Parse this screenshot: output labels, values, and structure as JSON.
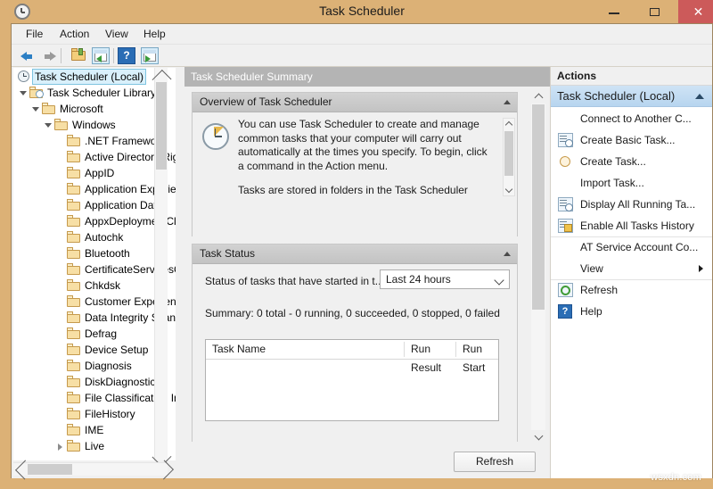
{
  "window": {
    "title": "Task Scheduler",
    "icon": "clock-icon",
    "minimize_label": "–",
    "maximize_label": "□",
    "close_label": "✕"
  },
  "menu": {
    "items": [
      {
        "label": "File"
      },
      {
        "label": "Action"
      },
      {
        "label": "View"
      },
      {
        "label": "Help"
      }
    ]
  },
  "toolbar": {
    "items": [
      {
        "name": "back-icon",
        "label": "Back"
      },
      {
        "name": "forward-icon",
        "label": "Forward"
      },
      {
        "name": "up-one-level-icon",
        "label": "Up One Level"
      },
      {
        "name": "show-hide-console-tree-icon",
        "label": "Show/Hide Console Tree"
      },
      {
        "name": "help-icon",
        "label": "Help"
      },
      {
        "name": "show-hide-action-pane-icon",
        "label": "Show/Hide Action Pane"
      }
    ]
  },
  "tree": {
    "items": [
      {
        "label": "Task Scheduler (Local)",
        "depth": 0,
        "icon": "clock-icon",
        "expander": "none",
        "selected": true
      },
      {
        "label": "Task Scheduler Library",
        "depth": 1,
        "icon": "clock-folder-icon",
        "expander": "open",
        "selected": false
      },
      {
        "label": "Microsoft",
        "depth": 2,
        "icon": "folder-icon",
        "expander": "open",
        "selected": false
      },
      {
        "label": "Windows",
        "depth": 3,
        "icon": "folder-icon",
        "expander": "open",
        "selected": false
      },
      {
        "label": ".NET Framework",
        "depth": 4,
        "icon": "folder-icon",
        "expander": "none",
        "selected": false
      },
      {
        "label": "Active Directory Rights Management",
        "depth": 4,
        "icon": "folder-icon",
        "expander": "none",
        "selected": false
      },
      {
        "label": "AppID",
        "depth": 4,
        "icon": "folder-icon",
        "expander": "none",
        "selected": false
      },
      {
        "label": "Application Experience",
        "depth": 4,
        "icon": "folder-icon",
        "expander": "none",
        "selected": false
      },
      {
        "label": "Application Data",
        "depth": 4,
        "icon": "folder-icon",
        "expander": "none",
        "selected": false
      },
      {
        "label": "AppxDeploymentClient",
        "depth": 4,
        "icon": "folder-icon",
        "expander": "none",
        "selected": false
      },
      {
        "label": "Autochk",
        "depth": 4,
        "icon": "folder-icon",
        "expander": "none",
        "selected": false
      },
      {
        "label": "Bluetooth",
        "depth": 4,
        "icon": "folder-icon",
        "expander": "none",
        "selected": false
      },
      {
        "label": "CertificateServicesClient",
        "depth": 4,
        "icon": "folder-icon",
        "expander": "none",
        "selected": false
      },
      {
        "label": "Chkdsk",
        "depth": 4,
        "icon": "folder-icon",
        "expander": "none",
        "selected": false
      },
      {
        "label": "Customer Experience Improvement Program",
        "depth": 4,
        "icon": "folder-icon",
        "expander": "none",
        "selected": false
      },
      {
        "label": "Data Integrity Scan",
        "depth": 4,
        "icon": "folder-icon",
        "expander": "none",
        "selected": false
      },
      {
        "label": "Defrag",
        "depth": 4,
        "icon": "folder-icon",
        "expander": "none",
        "selected": false
      },
      {
        "label": "Device Setup",
        "depth": 4,
        "icon": "folder-icon",
        "expander": "none",
        "selected": false
      },
      {
        "label": "Diagnosis",
        "depth": 4,
        "icon": "folder-icon",
        "expander": "none",
        "selected": false
      },
      {
        "label": "DiskDiagnostic",
        "depth": 4,
        "icon": "folder-icon",
        "expander": "none",
        "selected": false
      },
      {
        "label": "File Classification Infrastructure",
        "depth": 4,
        "icon": "folder-icon",
        "expander": "none",
        "selected": false
      },
      {
        "label": "FileHistory",
        "depth": 4,
        "icon": "folder-icon",
        "expander": "none",
        "selected": false
      },
      {
        "label": "IME",
        "depth": 4,
        "icon": "folder-icon",
        "expander": "none",
        "selected": false
      },
      {
        "label": "Live",
        "depth": 4,
        "icon": "folder-icon",
        "expander": "closed",
        "selected": false
      }
    ]
  },
  "center": {
    "header": "Task Scheduler Summary",
    "overview": {
      "title": "Overview of Task Scheduler",
      "paragraph1": "You can use Task Scheduler to create and manage common tasks that your computer will carry out automatically at the times you specify. To begin, click a command in the Action menu.",
      "paragraph2": "Tasks are stored in folders in the Task Scheduler Library. To view or perform an operation on an"
    },
    "task_status": {
      "title": "Task Status",
      "filter_label": "Status of tasks that have started in t...",
      "filter_value": "Last 24 hours",
      "summary": "Summary: 0 total - 0 running, 0 succeeded, 0 stopped, 0 failed",
      "columns": [
        "Task Name",
        "Run Result",
        "Run Start"
      ],
      "rows": []
    },
    "refresh_button": "Refresh"
  },
  "actions": {
    "header": "Actions",
    "group_title": "Task Scheduler (Local)",
    "items": [
      {
        "label": "Connect to Another C...",
        "icon": "none"
      },
      {
        "label": "Create Basic Task...",
        "icon": "create-basic-task-icon"
      },
      {
        "label": "Create Task...",
        "icon": "create-task-icon"
      },
      {
        "label": "Import Task...",
        "icon": "none"
      },
      {
        "label": "Display All Running Ta...",
        "icon": "display-running-tasks-icon"
      },
      {
        "label": "Enable All Tasks History",
        "icon": "enable-history-icon"
      },
      {
        "label": "AT Service Account Co...",
        "icon": "none"
      },
      {
        "label": "View",
        "icon": "none",
        "submenu": true
      },
      {
        "label": "Refresh",
        "icon": "refresh-icon"
      },
      {
        "label": "Help",
        "icon": "help-icon"
      }
    ]
  },
  "watermark": "wsxdn.com",
  "colors": {
    "frame": "#dcb176",
    "close_button": "#cc5a5a",
    "selection": "#d9f0fb",
    "actions_group": "#b7d5ef",
    "header_bar": "#b4b4b4"
  }
}
